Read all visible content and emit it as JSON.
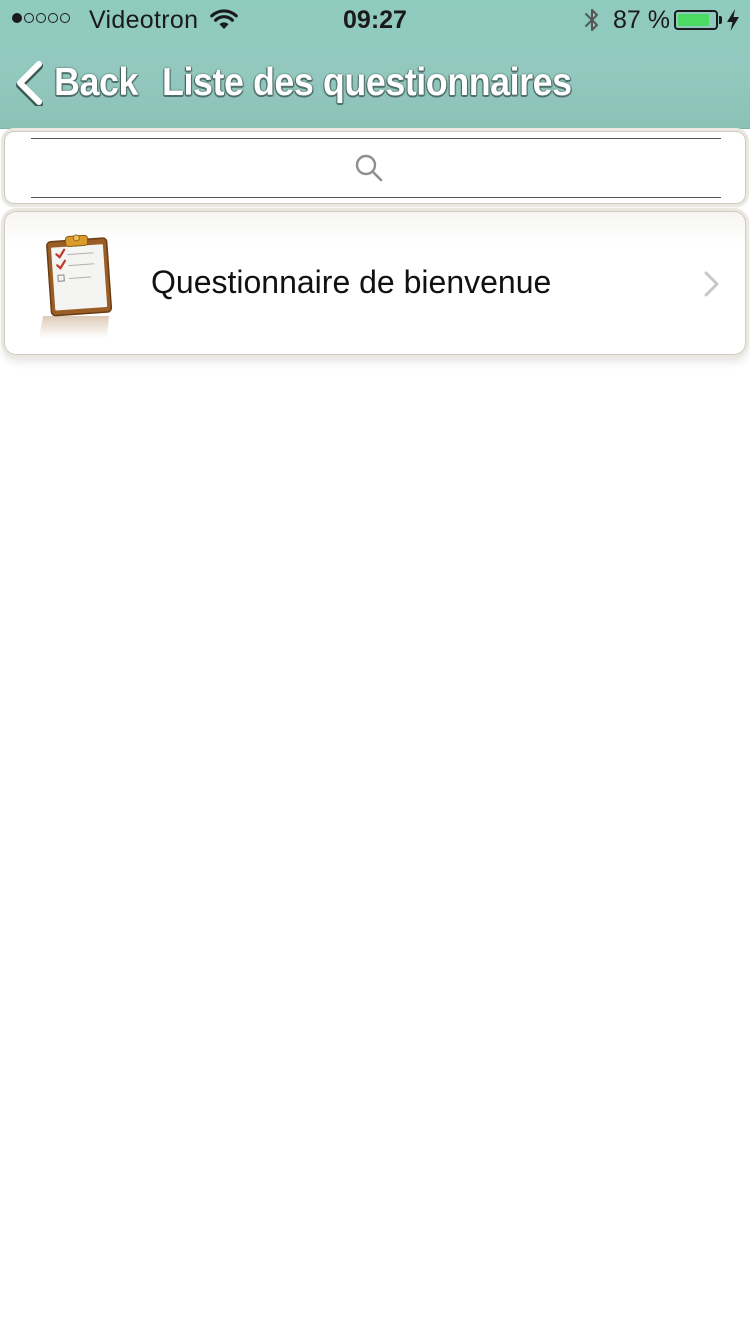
{
  "status_bar": {
    "signal_bars_filled": 1,
    "signal_bars_total": 5,
    "carrier": "Videotron",
    "time": "09:27",
    "battery_percent": "87 %",
    "battery_level": 0.87,
    "charging": true
  },
  "nav": {
    "back_label": "Back",
    "title": "Liste des questionnaires"
  },
  "search": {
    "placeholder": ""
  },
  "list": {
    "items": [
      {
        "label": "Questionnaire de bienvenue",
        "icon": "clipboard-checklist-icon"
      }
    ]
  },
  "colors": {
    "header_bg": "#93c8bf",
    "battery_fill": "#4cd964",
    "title_text": "#ffffff"
  }
}
